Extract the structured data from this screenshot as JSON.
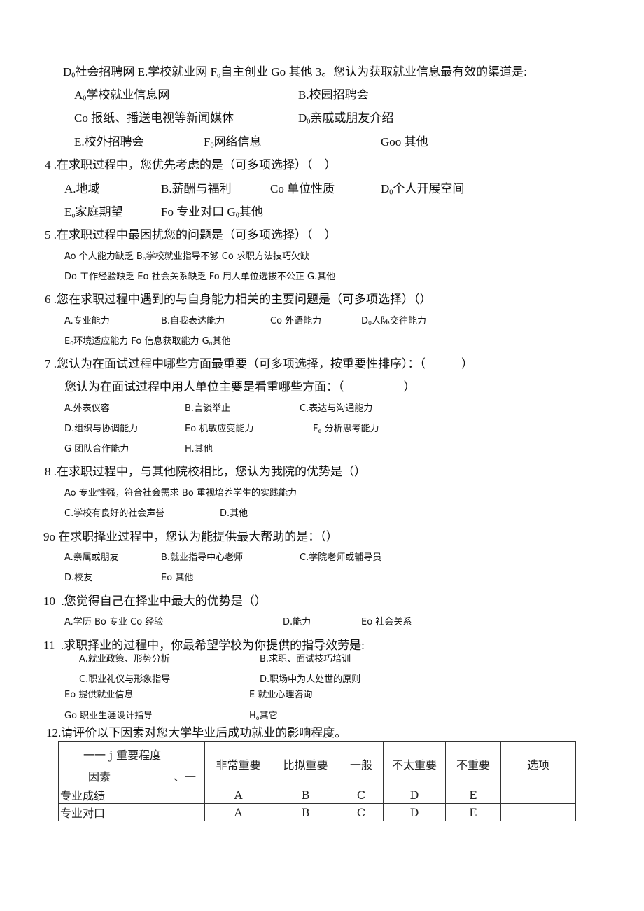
{
  "q3_tail": {
    "prev_options": [
      {
        "letter": "D",
        "sub": "0",
        "text": "社会招聘网"
      },
      {
        "letter": "E.",
        "sub": "",
        "text": "学校就业网"
      },
      {
        "letter": "F",
        "sub": "o",
        "text": "自主创业"
      },
      {
        "letter": "Go",
        "sub": "",
        "text": "其他"
      }
    ],
    "question": "3。您认为获取就业信息最有效的渠道是:",
    "options": [
      {
        "letter": "A",
        "sub": "0",
        "text": "学校就业信息网"
      },
      {
        "letter": "B.",
        "sub": "",
        "text": "校园招聘会"
      },
      {
        "letter": "Co",
        "sub": "",
        "text": "报纸、播送电视等新闻媒体"
      },
      {
        "letter": "D",
        "sub": "0",
        "text": "亲戚或朋友介绍"
      },
      {
        "letter": "E.",
        "sub": "",
        "text": "校外招聘会"
      },
      {
        "letter": "F",
        "sub": "0",
        "text": "网络信息"
      },
      {
        "letter": "Goo",
        "sub": "",
        "text": "其他"
      }
    ]
  },
  "q4": {
    "number": "4",
    "question": ".在求职过程中，您优先考虑的是（可多项选择）（　）",
    "options": [
      {
        "letter": "A.",
        "sub": "",
        "text": "地域"
      },
      {
        "letter": "B.",
        "sub": "",
        "text": "薪酬与福利"
      },
      {
        "letter": "Co",
        "sub": "",
        "text": "单位性质"
      },
      {
        "letter": "D",
        "sub": "0",
        "text": "个人开展空间"
      },
      {
        "letter": "E",
        "sub": "o",
        "text": "家庭期望"
      },
      {
        "letter": "Fo",
        "sub": "",
        "text": "专业对口"
      },
      {
        "letter": "G",
        "sub": "0",
        "text": "其他"
      }
    ]
  },
  "q5": {
    "number": "5",
    "question": ".在求职过程中最困扰您的问题是（可多项选择）（　）",
    "line1": [
      {
        "letter": "Ao",
        "sub": "",
        "text": "个人能力缺乏"
      },
      {
        "letter": "B",
        "sub": "o",
        "text": "学校就业指导不够"
      },
      {
        "letter": "Co",
        "sub": "",
        "text": "求职方法技巧欠缺"
      }
    ],
    "line2": [
      {
        "letter": "Do",
        "sub": "",
        "text": "工作经验缺乏"
      },
      {
        "letter": "Eo",
        "sub": "",
        "text": "社会关系缺乏"
      },
      {
        "letter": "Fo",
        "sub": "",
        "text": "用人单位选拔不公正"
      },
      {
        "letter": "G.",
        "sub": "",
        "text": "其他"
      }
    ]
  },
  "q6": {
    "number": "6",
    "question": ".您在求职过程中遇到的与自身能力相关的主要问题是（可多项选择）（）",
    "options": [
      {
        "letter": "A.",
        "sub": "",
        "text": "专业能力"
      },
      {
        "letter": "B.",
        "sub": "",
        "text": "自我表达能力"
      },
      {
        "letter": "Co",
        "sub": "",
        "text": "外语能力"
      },
      {
        "letter": "D",
        "sub": "0",
        "text": "人际交往能力"
      }
    ],
    "line2": [
      {
        "letter": "E",
        "sub": "0",
        "text": "环境适应能力"
      },
      {
        "letter": "Fo",
        "sub": "",
        "text": "信息获取能力"
      },
      {
        "letter": "G",
        "sub": "o",
        "text": "其他"
      }
    ]
  },
  "q7": {
    "number": "7",
    "question": ".您认为在面试过程中哪些方面最重要（可多项选择，按重要性排序）：（　　　）",
    "sub_question": "您认为在面试过程中用人单位主要是看重哪些方面：（　　　　　）",
    "options": [
      {
        "letter": "A.",
        "sub": "",
        "text": "外表仪容"
      },
      {
        "letter": "B.",
        "sub": "",
        "text": "言谈举止"
      },
      {
        "letter": "C.",
        "sub": "",
        "text": "表达与沟通能力"
      },
      {
        "letter": "D.",
        "sub": "",
        "text": "组织与协调能力"
      },
      {
        "letter": "Eo",
        "sub": "",
        "text": "机敏应变能力"
      },
      {
        "letter": "F",
        "sub": "e",
        "text": "分析思考能力"
      },
      {
        "letter": "G",
        "sub": "",
        "text": "团队合作能力"
      },
      {
        "letter": "H.",
        "sub": "",
        "text": "其他"
      }
    ]
  },
  "q8": {
    "number": "8",
    "question": ".在求职过程中，与其他院校相比，您认为我院的优势是（）",
    "line1": [
      {
        "letter": "Ao",
        "sub": "",
        "text": "专业性强，符合社会需求"
      },
      {
        "letter": "Bo",
        "sub": "",
        "text": "重视培养学生的实践能力"
      }
    ],
    "options": [
      {
        "letter": "C.",
        "sub": "",
        "text": "学校有良好的社会声誉"
      },
      {
        "letter": "D.",
        "sub": "",
        "text": "其他"
      }
    ]
  },
  "q9": {
    "number": "9o",
    "question": "在求职择业过程中，您认为能提供最大帮助的是：（）",
    "options": [
      {
        "letter": "A.",
        "sub": "",
        "text": "亲属或朋友"
      },
      {
        "letter": "B.",
        "sub": "",
        "text": "就业指导中心老师"
      },
      {
        "letter": "C.",
        "sub": "",
        "text": "学院老师或辅导员"
      },
      {
        "letter": "D.",
        "sub": "",
        "text": "校友"
      },
      {
        "letter": "Eo",
        "sub": "",
        "text": "其他"
      }
    ]
  },
  "q10": {
    "number": "10",
    "question": ".您觉得自己在择业中最大的优势是（）",
    "line1": [
      {
        "letter": "A.",
        "sub": "",
        "text": "学历"
      },
      {
        "letter": "Bo",
        "sub": "",
        "text": "专业"
      },
      {
        "letter": "Co",
        "sub": "",
        "text": "经验"
      }
    ],
    "options": [
      {
        "letter": "D.",
        "sub": "",
        "text": "能力"
      },
      {
        "letter": "Eo",
        "sub": "",
        "text": "社会关系"
      }
    ]
  },
  "q11": {
    "number": "11",
    "question": ".求职择业的过程中，你最希望学校为你提供的指导效劳是:",
    "options": [
      {
        "letter": "A.",
        "sub": "",
        "text": "就业政策、形势分析"
      },
      {
        "letter": "B.",
        "sub": "",
        "text": "求职、面试技巧培训"
      },
      {
        "letter": "C.",
        "sub": "",
        "text": "职业礼仪与形象指导"
      },
      {
        "letter": "D.",
        "sub": "",
        "text": "职场中为人处世的原则"
      },
      {
        "letter": "Eo",
        "sub": "",
        "text": "提供就业信息"
      },
      {
        "letter": "E",
        "sub": "",
        "text": "就业心理咨询"
      },
      {
        "letter": "Go",
        "sub": "",
        "text": "职业生涯设计指导"
      },
      {
        "letter": "H",
        "sub": "o",
        "text": "其它"
      }
    ]
  },
  "q12": {
    "question": "12.请评价以下因素对您大学毕业后成功就业的影响程度。",
    "table": {
      "corner_top": "一一 j 重要程度",
      "corner_bottom": "因素",
      "corner_mark": "、一",
      "headers": [
        "非常重要",
        "比拟重要",
        "一般",
        "不太重要",
        "不重要",
        "选项"
      ],
      "rows": [
        {
          "factor": "专业成绩",
          "cells": [
            "A",
            "B",
            "C",
            "D",
            "E",
            ""
          ]
        },
        {
          "factor": "专业对口",
          "cells": [
            "A",
            "B",
            "C",
            "D",
            "E",
            ""
          ]
        }
      ]
    }
  }
}
